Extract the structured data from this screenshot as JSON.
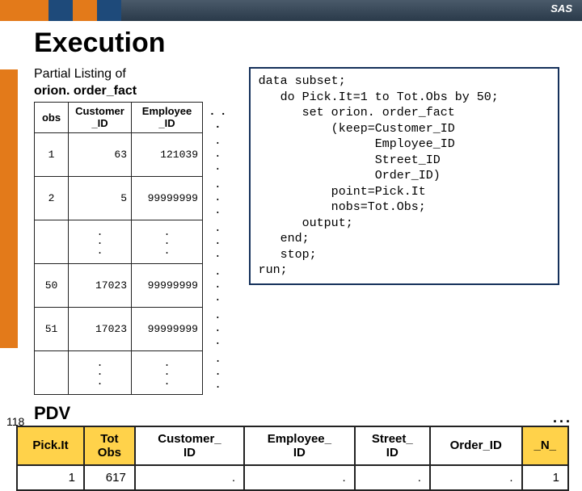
{
  "brand": "SAS",
  "title": "Execution",
  "listing_caption_l1": "Partial Listing of",
  "listing_caption_l2": "orion. order_fact",
  "table": {
    "h_obs": "obs",
    "h_cust": "Customer\n_ID",
    "h_emp": "Employee\n_ID",
    "ell": ". . .",
    "rows": [
      {
        "obs": "1",
        "cust": "63",
        "emp": "121039"
      },
      {
        "obs": "2",
        "cust": "5",
        "emp": "99999999"
      },
      {
        "obs": "",
        "cust": ".\n.\n.",
        "emp": ".\n.\n."
      },
      {
        "obs": "50",
        "cust": "17023",
        "emp": "99999999"
      },
      {
        "obs": "51",
        "cust": "17023",
        "emp": "99999999"
      },
      {
        "obs": "",
        "cust": ".\n.\n.",
        "emp": ".\n.\n."
      }
    ]
  },
  "code": "data subset;\n   do Pick.It=1 to Tot.Obs by 50;\n      set orion. order_fact\n          (keep=Customer_ID\n                Employee_ID\n                Street_ID\n                Order_ID)\n          point=Pick.It\n          nobs=Tot.Obs;\n      output;\n   end;\n   stop;\nrun;",
  "pdv": {
    "label": "PDV",
    "headers": [
      "Pick.It",
      "Tot\nObs",
      "Customer_\nID",
      "Employee_\nID",
      "Street_\nID",
      "Order_ID",
      "_N_"
    ],
    "values": [
      "1",
      "617",
      ".",
      ".",
      ".",
      ".",
      "1"
    ]
  },
  "page_num": "118",
  "corner": "..."
}
